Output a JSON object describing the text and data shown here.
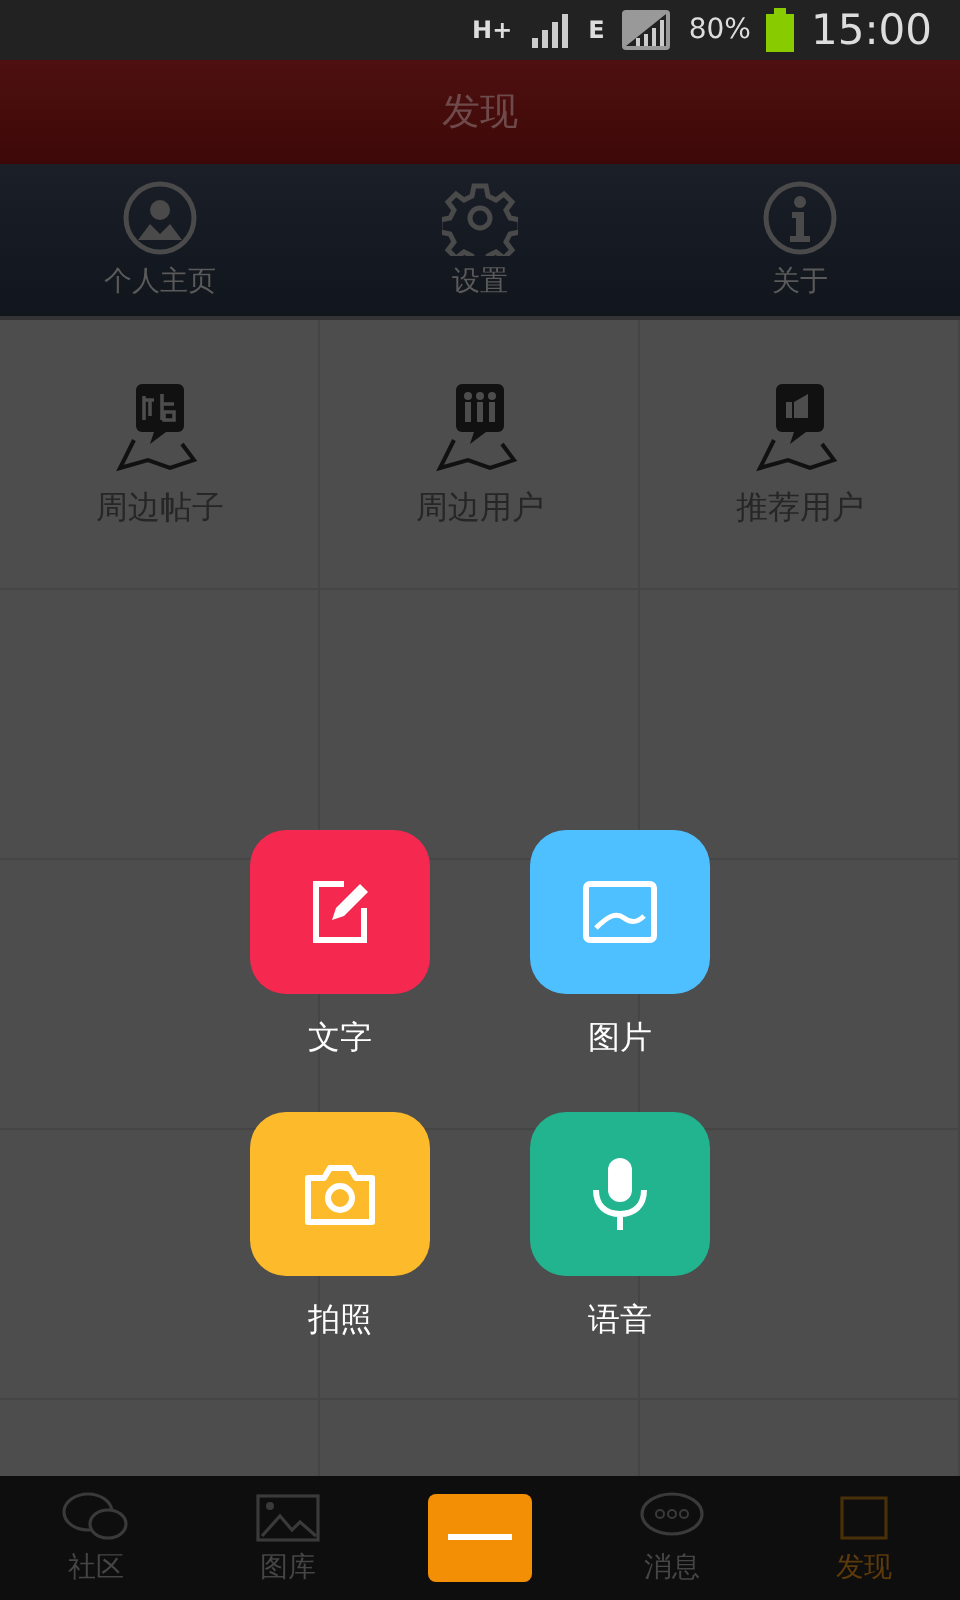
{
  "status_bar": {
    "network": "H+",
    "data": "E",
    "battery": "80%",
    "time": "15:00"
  },
  "title": "发现",
  "top_menu": [
    {
      "label": "个人主页"
    },
    {
      "label": "设置"
    },
    {
      "label": "关于"
    }
  ],
  "grid": [
    {
      "label": "周边帖子"
    },
    {
      "label": "周边用户"
    },
    {
      "label": "推荐用户"
    }
  ],
  "compose_options": [
    {
      "label": "文字",
      "color": "#f5284f"
    },
    {
      "label": "图片",
      "color": "#4ec0ff"
    },
    {
      "label": "拍照",
      "color": "#fdbb2c"
    },
    {
      "label": "语音",
      "color": "#22b48e"
    }
  ],
  "tab_bar": [
    {
      "label": "社区",
      "selected": false
    },
    {
      "label": "图库",
      "selected": false
    },
    {
      "label": "消息",
      "selected": false
    },
    {
      "label": "发现",
      "selected": true
    }
  ]
}
